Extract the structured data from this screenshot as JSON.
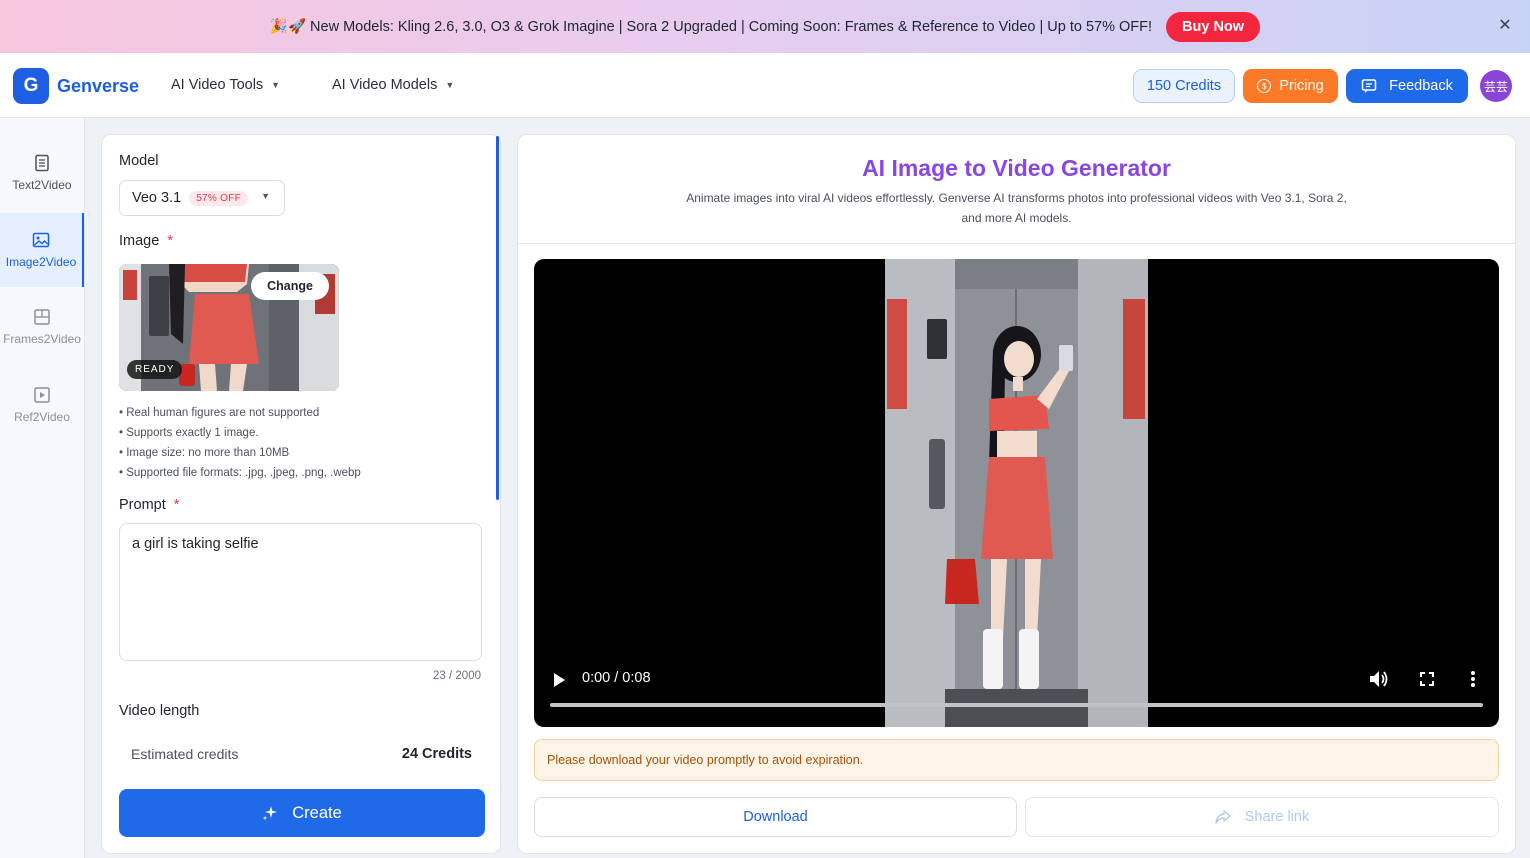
{
  "banner": {
    "text": "🎉🚀 New Models: Kling 2.6, 3.0, O3 & Grok Imagine | Sora 2 Upgraded | Coming Soon: Frames & Reference to Video | Up to 57% OFF!",
    "buy_label": "Buy Now",
    "close_icon": "✕"
  },
  "header": {
    "logo_letter": "G",
    "brand": "Genverse",
    "nav": [
      {
        "label": "AI Video Tools"
      },
      {
        "label": "AI Video Models"
      }
    ],
    "credits": "150 Credits",
    "pricing": "Pricing",
    "feedback": "Feedback",
    "avatar": "芸芸"
  },
  "sidebar": {
    "items": [
      {
        "label": "Text2Video",
        "icon": "document-icon"
      },
      {
        "label": "Image2Video",
        "icon": "image-icon",
        "active": true
      },
      {
        "label": "Frames2Video",
        "icon": "frames-icon"
      },
      {
        "label": "Ref2Video",
        "icon": "play-box-icon"
      }
    ]
  },
  "form": {
    "model_label": "Model",
    "model_value": "Veo 3.1",
    "model_badge": "57% OFF",
    "image_label": "Image",
    "required_mark": "*",
    "change_label": "Change",
    "ready_label": "READY",
    "notes": [
      "• Real human figures are not supported",
      "• Supports exactly 1 image.",
      "• Image size: no more than 10MB",
      "• Supported file formats: .jpg, .jpeg, .png, .webp"
    ],
    "prompt_label": "Prompt",
    "prompt_value": "a girl is taking selfie",
    "prompt_counter": "23 / 2000",
    "video_length_label": "Video length",
    "estimated_label": "Estimated credits",
    "estimated_value": "24 Credits",
    "create_label": "Create"
  },
  "result": {
    "title": "AI Image to Video Generator",
    "description": "Animate images into viral AI videos effortlessly. Genverse AI transforms photos into professional videos with Veo 3.1, Sora 2, and more AI models.",
    "player_time": "0:00 / 0:08",
    "progress": 0,
    "notice": "Please download your video promptly to avoid expiration.",
    "download_label": "Download",
    "share_label": "Share link"
  },
  "colors": {
    "primary": "#1f6ae8",
    "pricing": "#fb7a28",
    "buy": "#f4263f",
    "title": "#8a47e0"
  }
}
